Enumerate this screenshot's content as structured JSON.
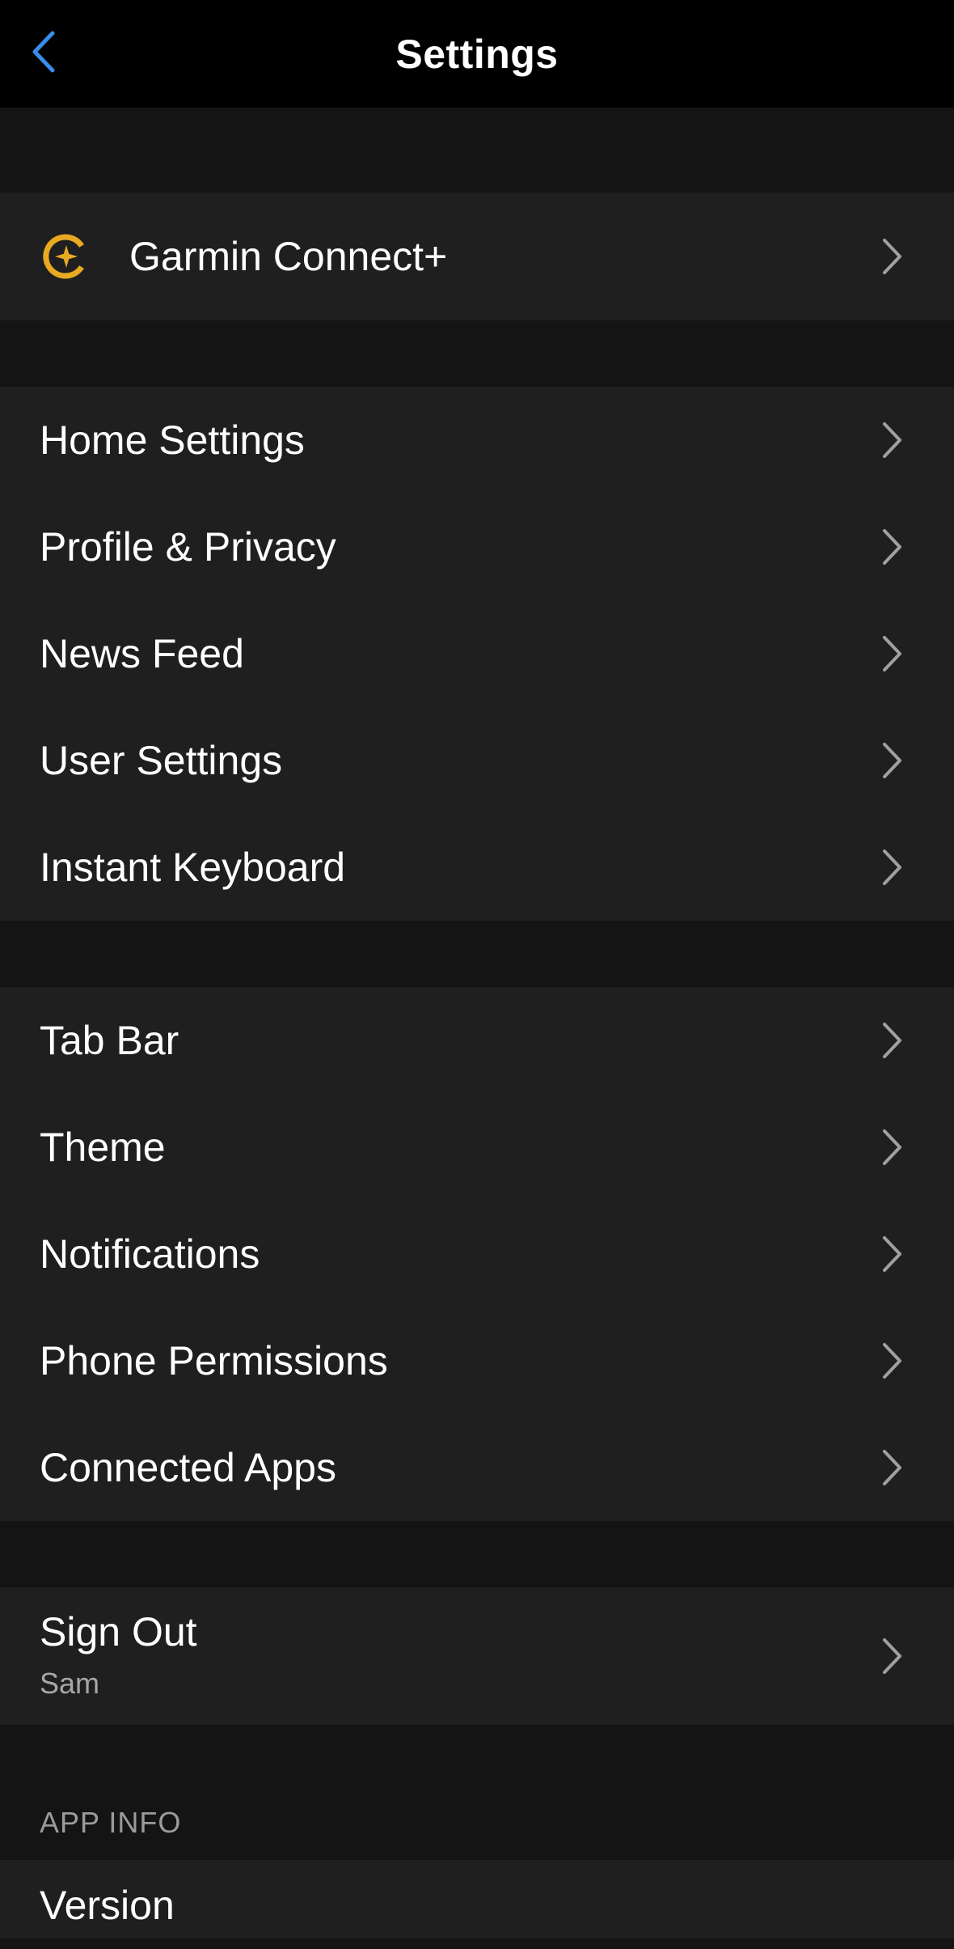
{
  "header": {
    "title": "Settings",
    "back_icon": "chevron-left-icon"
  },
  "colors": {
    "accent": "#3b8beb",
    "connect_gold": "#e8a922",
    "background": "#141414",
    "row_background": "#1f1f1f"
  },
  "connect_plus": {
    "label": "Garmin Connect+",
    "icon": "garmin-connect-plus-icon"
  },
  "group1": {
    "items": [
      {
        "label": "Home Settings"
      },
      {
        "label": "Profile & Privacy"
      },
      {
        "label": "News Feed"
      },
      {
        "label": "User Settings"
      },
      {
        "label": "Instant Keyboard"
      }
    ]
  },
  "group2": {
    "items": [
      {
        "label": "Tab Bar"
      },
      {
        "label": "Theme"
      },
      {
        "label": "Notifications"
      },
      {
        "label": "Phone Permissions"
      },
      {
        "label": "Connected Apps"
      }
    ]
  },
  "sign_out": {
    "label": "Sign Out",
    "user": "Sam"
  },
  "app_info": {
    "header": "APP INFO",
    "version_label": "Version"
  }
}
